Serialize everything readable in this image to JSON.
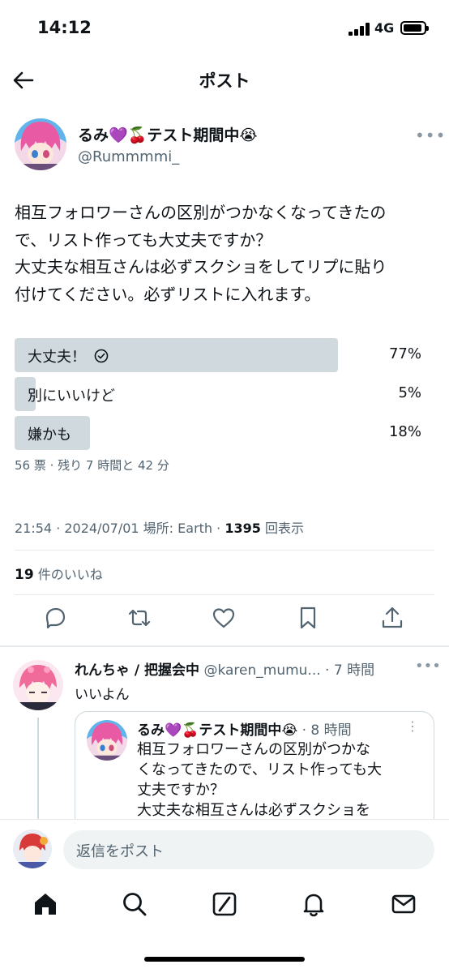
{
  "status_bar": {
    "time": "14:12",
    "network": "4G"
  },
  "header": {
    "title": "ポスト"
  },
  "tweet": {
    "display_name": "るみ💜🍒テスト期間中😭",
    "handle": "@Rummmmi_",
    "text_lines": [
      "相互フォロワーさんの区別がつかなくなってきたの",
      "で、リスト作っても大丈夫ですか？",
      "大丈夫な相互さんは必ずスクショをしてリプに貼り",
      "付けてください。必ずリストに入れます。"
    ],
    "poll": {
      "options": [
        {
          "label": "大丈夫！",
          "percent": "77%",
          "value": 77,
          "selected": true
        },
        {
          "label": "別にいいけど",
          "percent": "5%",
          "value": 5,
          "selected": false
        },
        {
          "label": "嫌かも",
          "percent": "18%",
          "value": 18,
          "selected": false
        }
      ],
      "meta": "56 票 · 残り 7 時間と 42 分"
    },
    "meta": {
      "time_place": "21:54 · 2024/07/01 場所: Earth · ",
      "views_count": "1395",
      "views_label": " 回表示"
    },
    "likes": {
      "count": "19",
      "label": " 件のいいね"
    }
  },
  "reply": {
    "display_name": "れんちゃ / 把握会中",
    "meta": " @karen_mumu... · 7 時間",
    "text": "いいよん",
    "quote": {
      "display_name": "るみ💜🍒テスト期間中😭",
      "time": " · 8 時間",
      "text_lines": [
        "相互フォロワーさんの区別がつかな",
        "くなってきたので、リスト作っても大",
        "丈夫ですか？",
        "大丈夫な相互さんは必ずスクショを"
      ]
    }
  },
  "compose": {
    "placeholder": "返信をポスト"
  },
  "colors": {
    "poll_bar": "#cfd9de",
    "secondary_text": "#536471",
    "border": "#e7ebee"
  },
  "icons": {
    "actions": [
      "reply-icon",
      "repost-icon",
      "like-icon",
      "bookmark-icon",
      "share-icon"
    ],
    "tabs": [
      "home-icon",
      "search-icon",
      "grok-icon",
      "notifications-icon",
      "messages-icon"
    ]
  }
}
